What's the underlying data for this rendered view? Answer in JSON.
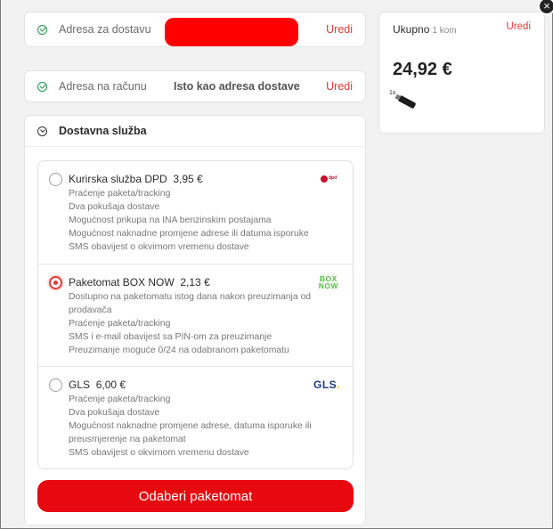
{
  "delivery_address": {
    "label": "Adresa za dostavu",
    "edit_label": "Uredi"
  },
  "billing_address": {
    "label": "Adresa na računu",
    "value": "Isto kao adresa dostave",
    "edit_label": "Uredi"
  },
  "shipping": {
    "title": "Dostavna služba",
    "options": [
      {
        "name": "Kurirska služba DPD",
        "price": "3,95 €",
        "logo": "dpd",
        "selected": false,
        "features": [
          "Praćenje paketa/tracking",
          "Dva pokušaja dostave",
          "Mogućnost prikupa na INA benzinskim postajama",
          "Mogućnost naknadne promjene adrese ili datuma isporuke",
          "SMS obavijest o okvirnom vremenu dostave"
        ]
      },
      {
        "name": "Paketomat BOX NOW",
        "price": "2,13 €",
        "logo": "box-now",
        "logo_lines": [
          "BOX",
          "NOW"
        ],
        "selected": true,
        "features": [
          "Dostupno na paketomatu istog dana nakon preuzimanja od",
          "prodavača",
          "Praćenje paketa/tracking",
          "SMS i e-mail obavijest sa PIN-om za preuzimanje",
          "Preuzimanje moguće 0/24 na odabranom paketomatu"
        ]
      },
      {
        "name": "GLS",
        "price": "6,00 €",
        "logo": "gls",
        "logo_text": "GLS",
        "selected": false,
        "features": [
          "Praćenje paketa/tracking",
          "Dva pokušaja dostave",
          "Mogućnost naknadne promjene adrese, datuma isporuke ili",
          "preusmjerenje na paketomat",
          "SMS obavijest o okvirnom vremenu dostave"
        ]
      }
    ],
    "cta_label": "Odaberi paketomat"
  },
  "summary": {
    "title": "Ukupno",
    "count": "1 kom",
    "edit_label": "Uredi",
    "total": "24,92 €",
    "item_qty": "1x"
  },
  "colors": {
    "accent": "#e8080f",
    "link": "#e53935",
    "success": "#1a9b4b"
  }
}
